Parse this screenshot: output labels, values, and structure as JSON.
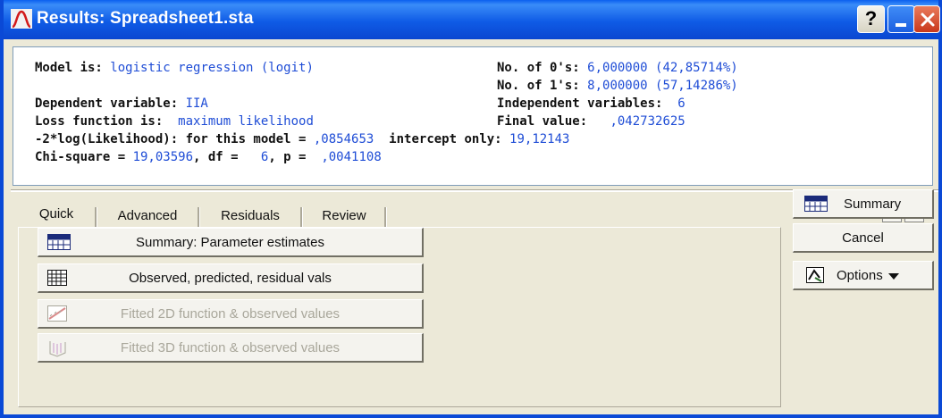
{
  "window": {
    "title": "Results: Spreadsheet1.sta",
    "controls": {
      "help": "?",
      "minimize": "minimize",
      "close": "close"
    }
  },
  "output": {
    "model_label": "Model is: ",
    "model_value": "logistic regression (logit)",
    "zeros_label": "No. of 0's: ",
    "zeros_value": "6,000000 (42,85714%)",
    "ones_label": "No. of 1's: ",
    "ones_value": "8,000000 (57,14286%)",
    "dep_label": "Dependent variable: ",
    "dep_value": "IIA",
    "indep_label": "Independent variables:  ",
    "indep_value": "6",
    "loss_label": "Loss function is:  ",
    "loss_value": "maximum likelihood",
    "final_label": "Final value:   ",
    "final_value": ",042732625",
    "lik_label": "-2*log(Likelihood): for this model = ",
    "lik_value": ",0854653",
    "intercept_label": "  intercept only: ",
    "intercept_value": "19,12143",
    "chi_label": "Chi-square = ",
    "chi_value": "19,03596",
    "df_label": ", df =   ",
    "df_value": "6",
    "p_label": ", p =  ",
    "p_value": ",0041108"
  },
  "tabs": [
    "Quick",
    "Advanced",
    "Residuals",
    "Review"
  ],
  "quick": {
    "summary_params": "Summary: Parameter estimates",
    "observed_vals": "Observed, predicted, residual vals",
    "fitted_2d": "Fitted 2D function & observed values",
    "fitted_3d": "Fitted 3D function & observed values"
  },
  "side": {
    "summary": "Summary",
    "cancel": "Cancel",
    "options": "Options"
  },
  "colors": {
    "title_bar": "#0a49d6",
    "value_text": "#1f4dd6",
    "dialog_bg": "#ece9d8",
    "disabled_text": "#a9a79b"
  }
}
